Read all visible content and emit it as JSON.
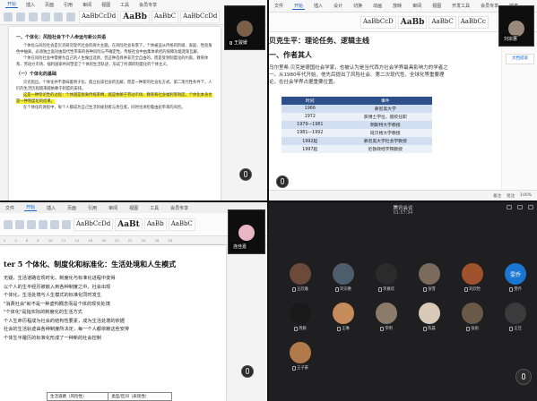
{
  "q1": {
    "ribbon_tabs": [
      "开始",
      "插入",
      "页面",
      "引用",
      "审阅",
      "视图",
      "工具",
      "会员专享"
    ],
    "styles": [
      "AaBbCcDd",
      "AaBb",
      "AaBbC",
      "AaBbCcDd"
    ],
    "camera_name": "王骏媛",
    "doc_heading": "一、个体化：风险社会下个人命运与新公共语",
    "para1": "个体化与风险社会是贝克研究现代社会的两大主题。在风险社会背景下，个体被迫从传统的阶级、家庭、性别角色中抽离，必须独立面对由现代性带来的各种风险与不确定性。传统社会中由集体承担的保障功能逐渐瓦解。",
    "para2": "个体在风险社会中需要为自己的人生做出选择，但这种选择并非完全自由的，而是受到制度化的约束。教育体系、劳动力市场、福利国家共同塑造了个体的生活轨迹，形成了所谓的制度化的个体主义。",
    "sub_heading": "（一）个体化的基础",
    "para3": "贝克指出，个体化并不意味着原子化、孤立化或社会的瓦解，而是一种新的社会化方式。第二现代性条件下，人们的生活历程越来越依赖于制度的安排。",
    "highlight": "这是一种悖论性的过程：个体越是脱离传统束缚，越是依赖于劳动市场、教育和社会福利等制度，个体化本身也是一种制度化的结果。",
    "para4": "在个体化的进程中，每个人都成为自己生活的规划者与责任者，同时也承担着由此带来的风险。"
  },
  "q2": {
    "nav_tabs": [
      "文件",
      "开始",
      "插入",
      "设计",
      "切换",
      "动画",
      "放映",
      "审阅",
      "视图",
      "开发工具",
      "会员专享",
      "效率"
    ],
    "camera_name": "刘宗惠",
    "title": "贝克生平：理论任务、逻辑主线",
    "title2": "一、作者其人",
    "body": "乌尔里希·贝克是德国社会学家，也被认为是当代西方社会学界最具影响力的学者之一。从1980年代开始，他先后提出了风险社会、第二次现代性、全球化等重要理论，在社会学界占据重要位置。",
    "table_head": [
      "时间",
      "事件"
    ],
    "table_rows": [
      [
        "1966",
        "慕尼黑大学"
      ],
      [
        "1972",
        "获博士学位，留校任职"
      ],
      [
        "1979—1981",
        "明斯特大学教授"
      ],
      [
        "1981—1992",
        "班贝格大学教授"
      ],
      [
        "1992起",
        "慕尼黑大学社会学教授"
      ],
      [
        "1997起",
        "伦敦政经学院教授"
      ]
    ],
    "side_button": "文档提取",
    "status": [
      "备注",
      "批注",
      "100%"
    ]
  },
  "q3": {
    "tabs": [
      "文件",
      "开始",
      "插入",
      "页面",
      "引用",
      "审阅",
      "视图",
      "工具",
      "会员专享"
    ],
    "styles": [
      "AaBbCcDd",
      "AaBt",
      "AaBb",
      "AaBbC"
    ],
    "camera_name": "连佳嘉",
    "chapter": "ter 5 个体化、制度化和标准化：生活处境和人生模式",
    "lines": [
      "无疑，生活道路在现时化、制度化与标准化进程中变得",
      "以个人的生平经历被嵌入到各种制度之中。社会出现",
      "个体化，生活处境与人生模式的标准化同时发生",
      "\"消费社会\"就不是一种虚构概念而是个体的现实处境",
      "\"个体化\"是指实际的制度化的生活方式",
      "个人生命历程成为社会的结构性要素，成为生活处境的依据",
      "社会的生活轨迹由各种制度所决定，每一个人都依赖这些安排",
      "个体生平履历的标准化形成了一种新的社会控制"
    ],
    "table": [
      [
        "生活道路（风险性）",
        "类型/区间（表现性）"
      ]
    ]
  },
  "q4": {
    "title": "腾讯会议",
    "time": "01:57:34",
    "participants": [
      {
        "name": "王欣雅",
        "color": "#6b4a3a"
      },
      {
        "name": "刘宗惠",
        "color": "#4e5d6c"
      },
      {
        "name": "李嘉欣",
        "color": "#2b2b2b"
      },
      {
        "name": "张雪",
        "color": "#7a6b5c"
      },
      {
        "name": "刘欣怡",
        "color": "#a0522d"
      },
      {
        "name": "雯乔",
        "color": "#1976d2"
      },
      {
        "name": "周颖",
        "color": "#1a1a1a"
      },
      {
        "name": "王琳",
        "color": "#c58b5b"
      },
      {
        "name": "李明",
        "color": "#8c7a6a"
      },
      {
        "name": "陈晨",
        "color": "#d8c9b8"
      },
      {
        "name": "张雨",
        "color": "#6a5848"
      },
      {
        "name": "王佳",
        "color": "#3b3b3b"
      },
      {
        "name": "王子豪",
        "color": "#b07a4a"
      }
    ],
    "avatar_label": "雯乔"
  }
}
